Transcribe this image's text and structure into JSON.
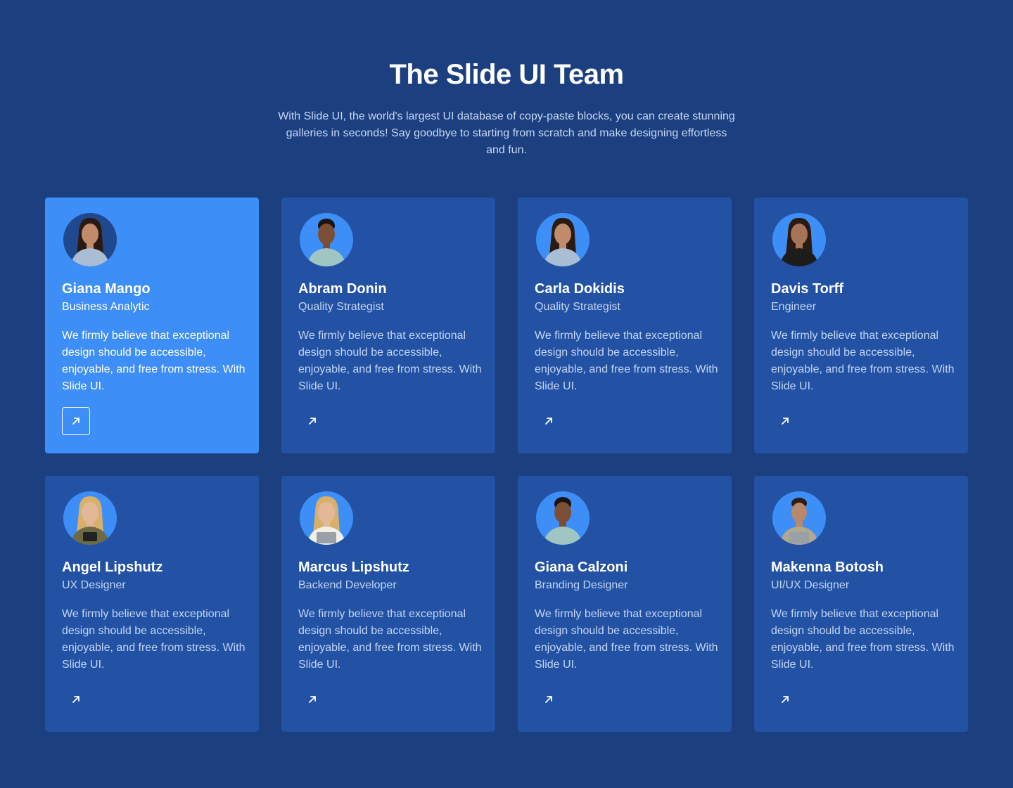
{
  "header": {
    "title": "The Slide UI Team",
    "subtitle": "With Slide UI, the world's largest UI database of copy-paste blocks, you can create stunning galleries in seconds! Say goodbye to starting from scratch and make designing effortless and fun."
  },
  "colors": {
    "background": "#1c3f80",
    "card": "#2352a5",
    "card_active": "#3e8ef7",
    "text_muted": "#c2d4f2"
  },
  "team": [
    {
      "name": "Giana Mango",
      "role": "Business Analytic",
      "bio": "We firmly believe that exceptional design should be accessible, enjoyable, and free from stress. With Slide UI.",
      "icon": "arrow-up-right-icon",
      "active": true
    },
    {
      "name": "Abram Donin",
      "role": "Quality Strategist",
      "bio": "We firmly believe that exceptional design should be accessible, enjoyable, and free from stress. With Slide UI.",
      "icon": "arrow-up-right-icon",
      "active": false
    },
    {
      "name": "Carla Dokidis",
      "role": "Quality Strategist",
      "bio": "We firmly believe that exceptional design should be accessible, enjoyable, and free from stress. With Slide UI.",
      "icon": "arrow-up-right-icon",
      "active": false
    },
    {
      "name": "Davis Torff",
      "role": "Engineer",
      "bio": "We firmly believe that exceptional design should be accessible, enjoyable, and free from stress. With Slide UI.",
      "icon": "arrow-up-right-icon",
      "active": false
    },
    {
      "name": "Angel Lipshutz",
      "role": "UX Designer",
      "bio": "We firmly believe that exceptional design should be accessible, enjoyable, and free from stress. With Slide UI.",
      "icon": "arrow-up-right-icon",
      "active": false
    },
    {
      "name": "Marcus Lipshutz",
      "role": "Backend Developer",
      "bio": "We firmly believe that exceptional design should be accessible, enjoyable, and free from stress. With Slide UI.",
      "icon": "arrow-up-right-icon",
      "active": false
    },
    {
      "name": "Giana Calzoni",
      "role": "Branding Designer",
      "bio": "We firmly believe that exceptional design should be accessible, enjoyable, and free from stress. With Slide UI.",
      "icon": "arrow-up-right-icon",
      "active": false
    },
    {
      "name": "Makenna Botosh",
      "role": "UI/UX Designer",
      "bio": "We firmly believe that exceptional design should be accessible, enjoyable, and free from stress. With Slide UI.",
      "icon": "arrow-up-right-icon",
      "active": false
    }
  ]
}
